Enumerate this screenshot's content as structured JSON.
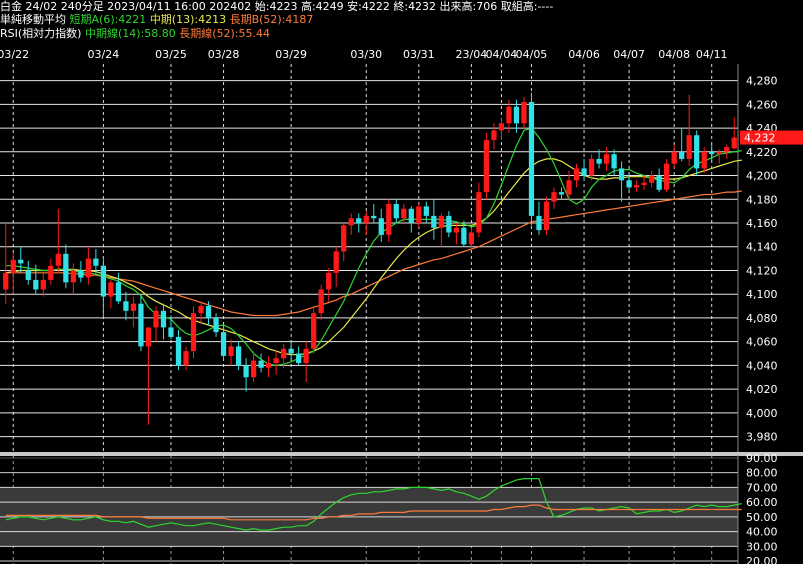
{
  "header": {
    "line1": "白金 24/02 240分足 2023/04/11 16:00 202402 始:4223 高:4249 安:4222 終:4232 出来高:706 取組高:----",
    "ma_title": "単純移動平均",
    "ma_short": "短期A(6):4221",
    "ma_mid": "中期(13):4213",
    "ma_long": "長期B(52):4187",
    "rsi_title": "RSI(相対力指数)",
    "rsi_mid": "中期線(14):58.80",
    "rsi_long": "長期線(52):55.44"
  },
  "colors": {
    "up": "#ff1a1a",
    "down": "#33e0e6",
    "ma_short": "#2fd52f",
    "ma_mid": "#e8e84a",
    "ma_long": "#ff7a3a",
    "grid": "#ffffff",
    "price_tag": "#ff1a1a",
    "background": "#000000"
  },
  "chart_data": [
    {
      "type": "candlestick",
      "title": "白金 24/02 240分足",
      "x_ticks": [
        "03/22",
        "03/24",
        "03/25",
        "03/28",
        "03/29",
        "03/30",
        "03/31",
        "23/04",
        "04/04",
        "04/05",
        "04/06",
        "04/07",
        "04/08",
        "04/11"
      ],
      "y_ticks": [
        "4,280",
        "4,260",
        "4,240",
        "4,220",
        "4,200",
        "4,180",
        "4,160",
        "4,140",
        "4,120",
        "4,100",
        "4,080",
        "4,060",
        "4,040",
        "4,020",
        "4,000",
        "3,980"
      ],
      "ylim": [
        3967,
        4294
      ],
      "last_price_label": "4,232",
      "last_price": 4232,
      "grid": true,
      "candles": [
        {
          "o": 4104,
          "h": 4160,
          "l": 4092,
          "c": 4118
        },
        {
          "o": 4118,
          "h": 4135,
          "l": 4100,
          "c": 4129
        },
        {
          "o": 4129,
          "h": 4140,
          "l": 4118,
          "c": 4126
        },
        {
          "o": 4120,
          "h": 4128,
          "l": 4108,
          "c": 4112
        },
        {
          "o": 4112,
          "h": 4125,
          "l": 4100,
          "c": 4104
        },
        {
          "o": 4104,
          "h": 4118,
          "l": 4098,
          "c": 4112
        },
        {
          "o": 4112,
          "h": 4130,
          "l": 4108,
          "c": 4124
        },
        {
          "o": 4124,
          "h": 4172,
          "l": 4118,
          "c": 4134
        },
        {
          "o": 4134,
          "h": 4142,
          "l": 4105,
          "c": 4110
        },
        {
          "o": 4110,
          "h": 4126,
          "l": 4100,
          "c": 4120
        },
        {
          "o": 4120,
          "h": 4128,
          "l": 4110,
          "c": 4114
        },
        {
          "o": 4114,
          "h": 4140,
          "l": 4108,
          "c": 4130
        },
        {
          "o": 4130,
          "h": 4138,
          "l": 4118,
          "c": 4124
        },
        {
          "o": 4124,
          "h": 4132,
          "l": 4080,
          "c": 4098
        },
        {
          "o": 4098,
          "h": 4112,
          "l": 4088,
          "c": 4110
        },
        {
          "o": 4110,
          "h": 4118,
          "l": 4092,
          "c": 4094
        },
        {
          "o": 4094,
          "h": 4102,
          "l": 4078,
          "c": 4086
        },
        {
          "o": 4086,
          "h": 4098,
          "l": 4072,
          "c": 4092
        },
        {
          "o": 4092,
          "h": 4100,
          "l": 4052,
          "c": 4056
        },
        {
          "o": 4056,
          "h": 4062,
          "l": 3990,
          "c": 4072
        },
        {
          "o": 4072,
          "h": 4090,
          "l": 4060,
          "c": 4086
        },
        {
          "o": 4086,
          "h": 4092,
          "l": 4062,
          "c": 4072
        },
        {
          "o": 4072,
          "h": 4082,
          "l": 4062,
          "c": 4064
        },
        {
          "o": 4064,
          "h": 4070,
          "l": 4036,
          "c": 4040
        },
        {
          "o": 4040,
          "h": 4056,
          "l": 4036,
          "c": 4052
        },
        {
          "o": 4052,
          "h": 4090,
          "l": 4046,
          "c": 4084
        },
        {
          "o": 4084,
          "h": 4094,
          "l": 4076,
          "c": 4090
        },
        {
          "o": 4090,
          "h": 4094,
          "l": 4074,
          "c": 4080
        },
        {
          "o": 4080,
          "h": 4084,
          "l": 4064,
          "c": 4068
        },
        {
          "o": 4068,
          "h": 4074,
          "l": 4044,
          "c": 4048
        },
        {
          "o": 4048,
          "h": 4062,
          "l": 4040,
          "c": 4056
        },
        {
          "o": 4056,
          "h": 4060,
          "l": 4036,
          "c": 4040
        },
        {
          "o": 4040,
          "h": 4046,
          "l": 4018,
          "c": 4030
        },
        {
          "o": 4030,
          "h": 4052,
          "l": 4026,
          "c": 4044
        },
        {
          "o": 4044,
          "h": 4050,
          "l": 4034,
          "c": 4038
        },
        {
          "o": 4038,
          "h": 4048,
          "l": 4030,
          "c": 4042
        },
        {
          "o": 4042,
          "h": 4052,
          "l": 4032,
          "c": 4046
        },
        {
          "o": 4046,
          "h": 4058,
          "l": 4038,
          "c": 4054
        },
        {
          "o": 4054,
          "h": 4060,
          "l": 4046,
          "c": 4050
        },
        {
          "o": 4050,
          "h": 4056,
          "l": 4040,
          "c": 4042
        },
        {
          "o": 4042,
          "h": 4060,
          "l": 4026,
          "c": 4054
        },
        {
          "o": 4054,
          "h": 4090,
          "l": 4050,
          "c": 4084
        },
        {
          "o": 4084,
          "h": 4108,
          "l": 4078,
          "c": 4104
        },
        {
          "o": 4104,
          "h": 4122,
          "l": 4094,
          "c": 4118
        },
        {
          "o": 4118,
          "h": 4140,
          "l": 4106,
          "c": 4136
        },
        {
          "o": 4136,
          "h": 4160,
          "l": 4128,
          "c": 4158
        },
        {
          "o": 4158,
          "h": 4168,
          "l": 4150,
          "c": 4164
        },
        {
          "o": 4164,
          "h": 4168,
          "l": 4152,
          "c": 4160
        },
        {
          "o": 4160,
          "h": 4170,
          "l": 4150,
          "c": 4166
        },
        {
          "o": 4166,
          "h": 4176,
          "l": 4160,
          "c": 4164
        },
        {
          "o": 4164,
          "h": 4172,
          "l": 4144,
          "c": 4150
        },
        {
          "o": 4150,
          "h": 4180,
          "l": 4144,
          "c": 4176
        },
        {
          "o": 4176,
          "h": 4180,
          "l": 4160,
          "c": 4164
        },
        {
          "o": 4164,
          "h": 4176,
          "l": 4160,
          "c": 4172
        },
        {
          "o": 4172,
          "h": 4174,
          "l": 4152,
          "c": 4160
        },
        {
          "o": 4160,
          "h": 4176,
          "l": 4156,
          "c": 4174
        },
        {
          "o": 4174,
          "h": 4178,
          "l": 4160,
          "c": 4166
        },
        {
          "o": 4166,
          "h": 4180,
          "l": 4146,
          "c": 4156
        },
        {
          "o": 4156,
          "h": 4168,
          "l": 4140,
          "c": 4166
        },
        {
          "o": 4166,
          "h": 4170,
          "l": 4148,
          "c": 4152
        },
        {
          "o": 4152,
          "h": 4160,
          "l": 4142,
          "c": 4156
        },
        {
          "o": 4156,
          "h": 4162,
          "l": 4140,
          "c": 4142
        },
        {
          "o": 4142,
          "h": 4156,
          "l": 4138,
          "c": 4152
        },
        {
          "o": 4152,
          "h": 4194,
          "l": 4148,
          "c": 4186
        },
        {
          "o": 4186,
          "h": 4236,
          "l": 4180,
          "c": 4230
        },
        {
          "o": 4230,
          "h": 4244,
          "l": 4222,
          "c": 4238
        },
        {
          "o": 4238,
          "h": 4248,
          "l": 4230,
          "c": 4244
        },
        {
          "o": 4244,
          "h": 4264,
          "l": 4236,
          "c": 4258
        },
        {
          "o": 4258,
          "h": 4264,
          "l": 4236,
          "c": 4244
        },
        {
          "o": 4244,
          "h": 4266,
          "l": 4240,
          "c": 4262
        },
        {
          "o": 4262,
          "h": 4270,
          "l": 4158,
          "c": 4166
        },
        {
          "o": 4166,
          "h": 4178,
          "l": 4150,
          "c": 4154
        },
        {
          "o": 4154,
          "h": 4182,
          "l": 4150,
          "c": 4178
        },
        {
          "o": 4178,
          "h": 4190,
          "l": 4172,
          "c": 4186
        },
        {
          "o": 4186,
          "h": 4190,
          "l": 4180,
          "c": 4184
        },
        {
          "o": 4184,
          "h": 4204,
          "l": 4180,
          "c": 4196
        },
        {
          "o": 4196,
          "h": 4210,
          "l": 4190,
          "c": 4206
        },
        {
          "o": 4206,
          "h": 4214,
          "l": 4196,
          "c": 4200
        },
        {
          "o": 4200,
          "h": 4218,
          "l": 4196,
          "c": 4214
        },
        {
          "o": 4214,
          "h": 4222,
          "l": 4206,
          "c": 4210
        },
        {
          "o": 4210,
          "h": 4224,
          "l": 4204,
          "c": 4218
        },
        {
          "o": 4218,
          "h": 4222,
          "l": 4200,
          "c": 4206
        },
        {
          "o": 4206,
          "h": 4212,
          "l": 4178,
          "c": 4196
        },
        {
          "o": 4196,
          "h": 4202,
          "l": 4188,
          "c": 4190
        },
        {
          "o": 4190,
          "h": 4196,
          "l": 4186,
          "c": 4192
        },
        {
          "o": 4192,
          "h": 4200,
          "l": 4188,
          "c": 4194
        },
        {
          "o": 4194,
          "h": 4204,
          "l": 4190,
          "c": 4200
        },
        {
          "o": 4200,
          "h": 4206,
          "l": 4186,
          "c": 4188
        },
        {
          "o": 4188,
          "h": 4214,
          "l": 4186,
          "c": 4210
        },
        {
          "o": 4210,
          "h": 4226,
          "l": 4206,
          "c": 4220
        },
        {
          "o": 4220,
          "h": 4240,
          "l": 4212,
          "c": 4214
        },
        {
          "o": 4214,
          "h": 4268,
          "l": 4208,
          "c": 4234
        },
        {
          "o": 4234,
          "h": 4238,
          "l": 4200,
          "c": 4206
        },
        {
          "o": 4206,
          "h": 4224,
          "l": 4202,
          "c": 4220
        },
        {
          "o": 4220,
          "h": 4226,
          "l": 4212,
          "c": 4218
        },
        {
          "o": 4218,
          "h": 4222,
          "l": 4210,
          "c": 4220
        },
        {
          "o": 4220,
          "h": 4226,
          "l": 4214,
          "c": 4224
        },
        {
          "o": 4223,
          "h": 4249,
          "l": 4222,
          "c": 4232
        }
      ],
      "ma_short": [
        4124,
        4124,
        4123,
        4122,
        4121,
        4120,
        4120,
        4121,
        4121,
        4120,
        4118,
        4118,
        4117,
        4115,
        4113,
        4111,
        4107,
        4104,
        4099,
        4089,
        4083,
        4081,
        4079,
        4072,
        4067,
        4065,
        4067,
        4070,
        4073,
        4074,
        4071,
        4065,
        4058,
        4050,
        4045,
        4041,
        4040,
        4041,
        4043,
        4046,
        4049,
        4052,
        4061,
        4072,
        4083,
        4094,
        4108,
        4122,
        4134,
        4145,
        4152,
        4156,
        4160,
        4163,
        4163,
        4163,
        4163,
        4163,
        4163,
        4162,
        4161,
        4159,
        4157,
        4158,
        4164,
        4176,
        4192,
        4209,
        4225,
        4238,
        4240,
        4232,
        4222,
        4210,
        4195,
        4180,
        4176,
        4180,
        4190,
        4197,
        4200,
        4204,
        4205,
        4205,
        4202,
        4200,
        4198,
        4196,
        4195,
        4194,
        4198,
        4205,
        4210,
        4212,
        4215,
        4218,
        4219,
        4220,
        4221
      ],
      "ma_mid": [
        4118,
        4119,
        4120,
        4120,
        4120,
        4120,
        4120,
        4121,
        4121,
        4121,
        4120,
        4120,
        4119,
        4117,
        4115,
        4113,
        4110,
        4107,
        4103,
        4098,
        4094,
        4091,
        4088,
        4085,
        4081,
        4078,
        4076,
        4074,
        4072,
        4070,
        4068,
        4066,
        4063,
        4060,
        4057,
        4054,
        4052,
        4050,
        4049,
        4049,
        4050,
        4052,
        4055,
        4060,
        4066,
        4072,
        4080,
        4088,
        4096,
        4105,
        4114,
        4122,
        4130,
        4137,
        4143,
        4148,
        4152,
        4155,
        4157,
        4158,
        4158,
        4158,
        4158,
        4160,
        4164,
        4170,
        4178,
        4186,
        4194,
        4202,
        4208,
        4212,
        4214,
        4214,
        4212,
        4208,
        4204,
        4200,
        4198,
        4197,
        4197,
        4198,
        4198,
        4199,
        4199,
        4199,
        4198,
        4198,
        4197,
        4197,
        4198,
        4200,
        4202,
        4204,
        4206,
        4208,
        4210,
        4212,
        4213
      ],
      "ma_long": [
        4118,
        4118,
        4118,
        4118,
        4118,
        4118,
        4118,
        4118,
        4118,
        4117,
        4117,
        4116,
        4116,
        4115,
        4114,
        4113,
        4112,
        4111,
        4109,
        4107,
        4105,
        4103,
        4101,
        4099,
        4097,
        4095,
        4093,
        4091,
        4089,
        4087,
        4085,
        4084,
        4083,
        4082,
        4082,
        4082,
        4082,
        4083,
        4084,
        4085,
        4087,
        4089,
        4091,
        4093,
        4095,
        4098,
        4100,
        4103,
        4106,
        4109,
        4112,
        4115,
        4118,
        4121,
        4123,
        4125,
        4127,
        4129,
        4130,
        4132,
        4134,
        4136,
        4138,
        4140,
        4143,
        4146,
        4149,
        4152,
        4155,
        4158,
        4161,
        4162,
        4163,
        4164,
        4165,
        4166,
        4167,
        4168,
        4169,
        4170,
        4171,
        4172,
        4173,
        4174,
        4175,
        4176,
        4177,
        4178,
        4179,
        4180,
        4181,
        4182,
        4183,
        4184,
        4184,
        4185,
        4186,
        4186,
        4187
      ]
    },
    {
      "type": "line",
      "title": "RSI(相対力指数)",
      "y_ticks": [
        "90.00",
        "80.00",
        "70.00",
        "60.00",
        "50.00",
        "40.00",
        "30.00",
        "20.00"
      ],
      "ylim": [
        18,
        92
      ],
      "grid": true,
      "series": [
        {
          "name": "中期線(14)",
          "color": "#2fd52f",
          "values": [
            48,
            49,
            50,
            50,
            49,
            48,
            49,
            50,
            49,
            48,
            48,
            49,
            50,
            48,
            47,
            47,
            46,
            47,
            45,
            43,
            44,
            45,
            46,
            45,
            44,
            44,
            45,
            46,
            45,
            44,
            43,
            42,
            41,
            42,
            41,
            41,
            42,
            43,
            43,
            44,
            44,
            47,
            52,
            56,
            60,
            63,
            65,
            66,
            66,
            67,
            67,
            68,
            69,
            69,
            70,
            70,
            70,
            69,
            68,
            69,
            67,
            66,
            64,
            62,
            64,
            68,
            71,
            73,
            75,
            76,
            76,
            76,
            60,
            50,
            51,
            53,
            55,
            56,
            56,
            54,
            55,
            56,
            57,
            56,
            52,
            53,
            54,
            54,
            55,
            53,
            54,
            56,
            58,
            57,
            58,
            57,
            57,
            58,
            59
          ]
        },
        {
          "name": "長期線(52)",
          "color": "#ff7a3a",
          "values": [
            51,
            51,
            51,
            51,
            51,
            51,
            51,
            51,
            51,
            51,
            51,
            51,
            51,
            50,
            50,
            50,
            50,
            50,
            50,
            49,
            49,
            49,
            49,
            49,
            49,
            49,
            49,
            49,
            49,
            49,
            48,
            48,
            48,
            48,
            48,
            48,
            48,
            48,
            48,
            48,
            48,
            49,
            49,
            50,
            50,
            51,
            51,
            52,
            52,
            52,
            53,
            53,
            53,
            53,
            54,
            54,
            54,
            54,
            54,
            54,
            54,
            54,
            54,
            54,
            54,
            55,
            55,
            56,
            57,
            57,
            58,
            58,
            56,
            55,
            55,
            55,
            55,
            55,
            55,
            55,
            55,
            55,
            55,
            55,
            55,
            55,
            55,
            55,
            55,
            55,
            55,
            55,
            55,
            55,
            55,
            55,
            55,
            55,
            55
          ]
        }
      ]
    }
  ]
}
